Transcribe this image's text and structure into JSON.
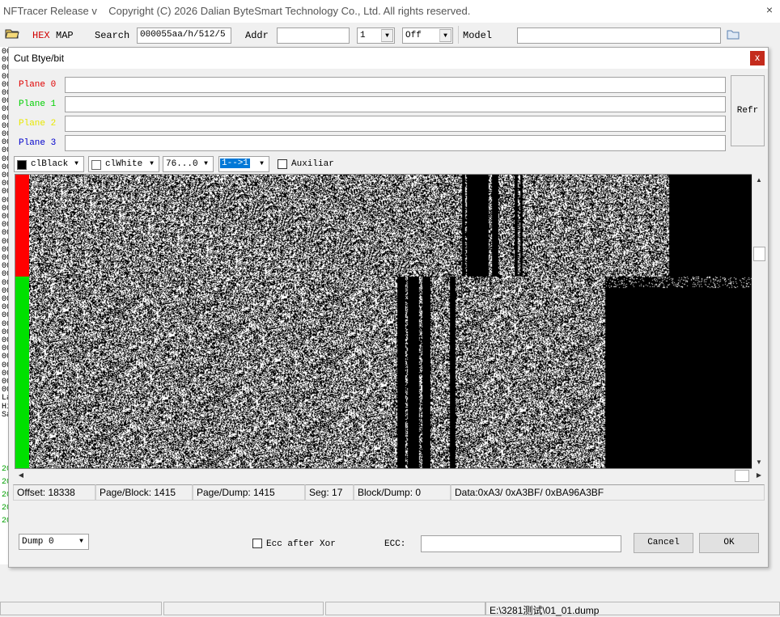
{
  "app": {
    "title": "NFTracer Release v",
    "copyright": "Copyright (C) 2026 Dalian ByteSmart Technology Co., Ltd. All rights reserved."
  },
  "toolbar": {
    "hex_label": "HEX",
    "map_label": "MAP",
    "search_label": "Search",
    "search_value": "000055aa/h/512/5",
    "addr_label": "Addr",
    "addr_value": "",
    "count_value": "1",
    "mode_value": "Off",
    "model_label": "Model",
    "model_value": ""
  },
  "background_window": {
    "left_glyphs": [
      "00",
      "00",
      "00",
      "00",
      "00",
      "00",
      "00",
      "00",
      "00",
      "00",
      "00",
      "00",
      "00",
      "00",
      "00",
      "00",
      "00",
      "00",
      "00",
      "00",
      "00",
      "00",
      "00",
      "00",
      "00",
      "00",
      "00",
      "00",
      "00",
      "00",
      "00",
      "00",
      "00",
      "00",
      "00",
      "00",
      "00",
      "00",
      "00",
      "00",
      "00",
      "00",
      "La",
      "Hi",
      "Sa"
    ],
    "lower_glyphs": [
      "20",
      "20",
      "20",
      "20",
      "20"
    ]
  },
  "dialog": {
    "title": "Cut Btye/bit",
    "close_label": "x",
    "planes": [
      {
        "label": "Plane 0",
        "color": "#e00000",
        "value": ""
      },
      {
        "label": "Plane 1",
        "color": "#00d000",
        "value": ""
      },
      {
        "label": "Plane 2",
        "color": "#e8e800",
        "value": ""
      },
      {
        "label": "Plane 3",
        "color": "#0000cc",
        "value": ""
      }
    ],
    "refresh_label": "Refr",
    "fg_color_value": "clBlack",
    "bg_color_value": "clWhite",
    "bit_range_value": "76...0",
    "bit_map_value": "1-->1",
    "auxiliar_label": "Auxiliar",
    "status": {
      "offset": "Offset: 18338",
      "page_block": "Page/Block: 1415",
      "page_dump": "Page/Dump: 1415",
      "seg": "Seg: 17",
      "block_dump": "Block/Dump: 0",
      "data": "Data:0xA3/ 0xA3BF/ 0xBA96A3BF"
    },
    "dump_value": "Dump 0",
    "ecc_after_xor_label": "Ecc after Xor",
    "ecc_label": "ECC:",
    "ecc_value": "",
    "cancel_label": "Cancel",
    "ok_label": "OK",
    "band_colors": {
      "top": "#ff0000",
      "bottom": "#00e000"
    }
  },
  "statusbar": {
    "file_path": "E:\\3281测试\\01_01.dump"
  }
}
